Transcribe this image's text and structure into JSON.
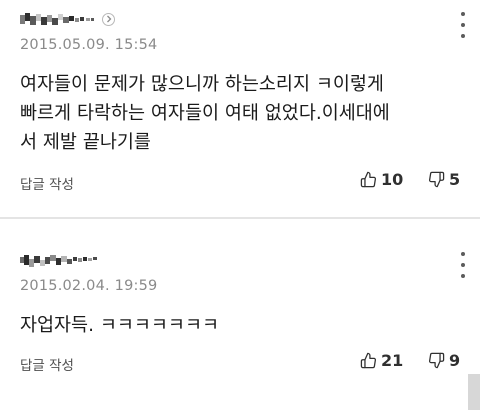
{
  "comments": [
    {
      "timestamp": "2015.05.09. 15:54",
      "text": "여자들이 문제가 많으니까 하는소리지 ㅋ이렇게\n빠르게 타락하는 여자들이 여태 없었다.이세대에\n서 제발 끝나기를",
      "reply_label": "답글 작성",
      "like_count": "10",
      "dislike_count": "5",
      "icons": {
        "profile": "chevron-right-icon",
        "like": "thumbs-up-icon",
        "dislike": "thumbs-down-icon",
        "more": "more-vertical-icon"
      }
    },
    {
      "timestamp": "2015.02.04. 19:59",
      "text": "자업자득. ㅋㅋㅋㅋㅋㅋㅋ",
      "reply_label": "답글 작성",
      "like_count": "21",
      "dislike_count": "9",
      "icons": {
        "like": "thumbs-up-icon",
        "dislike": "thumbs-down-icon",
        "more": "more-vertical-icon"
      }
    }
  ],
  "colors": {
    "text": "#1b1b1b",
    "meta": "#8a8a8a",
    "divider": "#e4e4e4",
    "icon": "#303030"
  }
}
